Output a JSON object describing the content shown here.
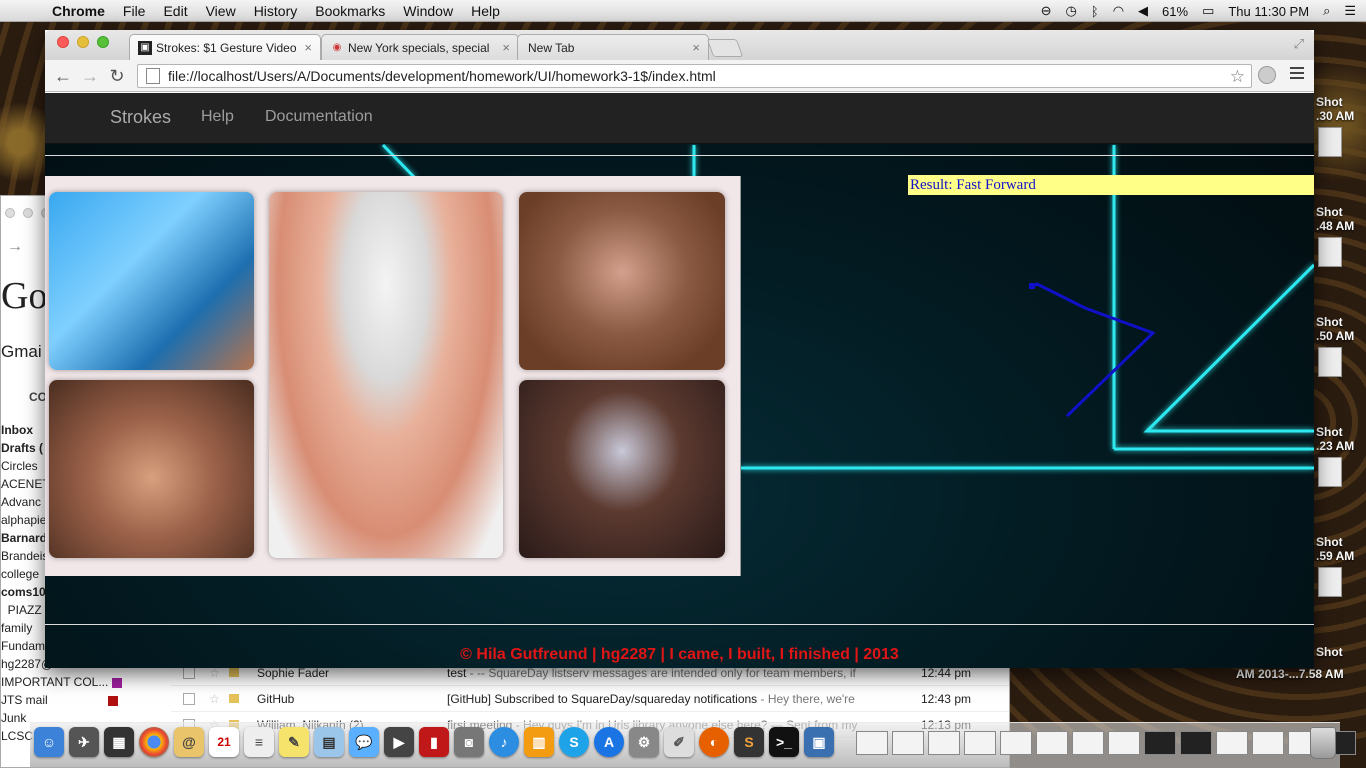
{
  "menubar": {
    "app_name": "Chrome",
    "items": [
      "File",
      "Edit",
      "View",
      "History",
      "Bookmarks",
      "Window",
      "Help"
    ],
    "battery": "61%",
    "clock": "Thu 11:30 PM"
  },
  "browser": {
    "tabs": [
      {
        "title": "Strokes: $1 Gesture Video",
        "active": true
      },
      {
        "title": "New York specials, special",
        "active": false
      },
      {
        "title": "New Tab",
        "active": false
      }
    ],
    "url": "file://localhost/Users/A/Documents/development/homework/UI/homework3-1$/index.html"
  },
  "page": {
    "nav": {
      "brand": "Strokes",
      "help": "Help",
      "documentation": "Documentation"
    },
    "result": "Result: Fast Forward",
    "footer": "© Hila Gutfreund | hg2287 | I came, I built, I finished | 2013",
    "colors": {
      "accent_cyan": "#2ee8f0",
      "stroke": "#1010c8",
      "result_bg": "#ffff88",
      "footer_red": "#e01515"
    }
  },
  "gmail": {
    "logo": "Go",
    "label": "Gmai",
    "compose": "CO",
    "sidebar": [
      {
        "text": "Inbox",
        "bold": true
      },
      {
        "text": "Drafts (",
        "bold": true
      },
      {
        "text": "Circles",
        "bold": false
      },
      {
        "text": "ACENET",
        "bold": false
      },
      {
        "text": "Advanc",
        "bold": false
      },
      {
        "text": "alphapie",
        "bold": false
      },
      {
        "text": "Barnard",
        "bold": true
      },
      {
        "text": "Brandeis",
        "bold": false
      },
      {
        "text": "college",
        "bold": false
      },
      {
        "text": "coms10",
        "bold": true
      },
      {
        "text": "  PIAZZ",
        "bold": false
      },
      {
        "text": "family",
        "bold": false
      },
      {
        "text": "Fundam",
        "bold": false
      },
      {
        "text": "hg2287@columbia...",
        "bold": false
      },
      {
        "text": "IMPORTANT COL...",
        "bold": false,
        "swatch": "#a020a0"
      },
      {
        "text": "JTS mail",
        "bold": false,
        "swatch": "#b01010"
      },
      {
        "text": "Junk",
        "bold": false
      },
      {
        "text": "LCSC",
        "bold": false
      }
    ],
    "rows": [
      {
        "from": "Sophie Fader",
        "subject": "test",
        "snippet": " - -- SquareDay listserv messages are intended only for team members, if",
        "time": "12:44 pm"
      },
      {
        "from": "GitHub",
        "subject": "[GitHub] Subscribed to SquareDay/squareday notifications",
        "snippet": " - Hey there, we're",
        "time": "12:43 pm"
      },
      {
        "from": "William, Nilkanth (2)",
        "subject": "first meeting",
        "snippet": " - Hey guys I'm in Uris library anyone else here? — Sent from my",
        "time": "12:13 pm"
      }
    ]
  },
  "desktop": {
    "shots": [
      {
        "label": "Shot",
        "time": ".30 AM"
      },
      {
        "label": "Shot",
        "time": ".48 AM"
      },
      {
        "label": "Shot",
        "time": ".50 AM"
      },
      {
        "label": "Shot",
        "time": ".23 AM"
      },
      {
        "label": "Shot",
        "time": ".59 AM"
      },
      {
        "label": "Shot",
        "time": "AM 2013-...7.58 AM"
      }
    ]
  },
  "dock": {
    "calendar_day": "21"
  }
}
